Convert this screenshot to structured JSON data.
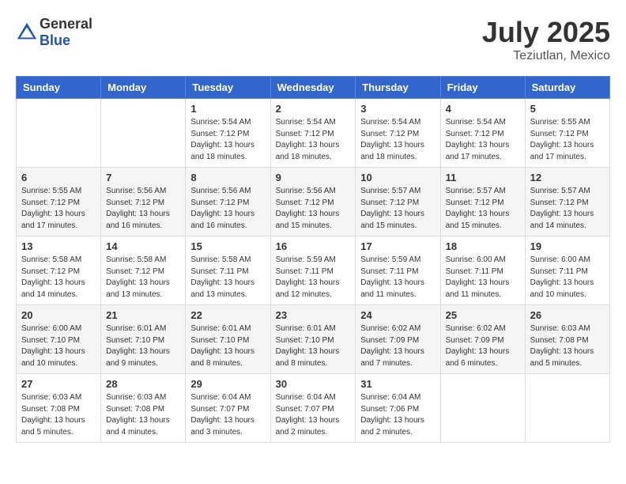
{
  "header": {
    "logo_general": "General",
    "logo_blue": "Blue",
    "month": "July 2025",
    "location": "Teziutlan, Mexico"
  },
  "weekdays": [
    "Sunday",
    "Monday",
    "Tuesday",
    "Wednesday",
    "Thursday",
    "Friday",
    "Saturday"
  ],
  "weeks": [
    [
      {
        "day": "",
        "info": ""
      },
      {
        "day": "",
        "info": ""
      },
      {
        "day": "1",
        "info": "Sunrise: 5:54 AM\nSunset: 7:12 PM\nDaylight: 13 hours\nand 18 minutes."
      },
      {
        "day": "2",
        "info": "Sunrise: 5:54 AM\nSunset: 7:12 PM\nDaylight: 13 hours\nand 18 minutes."
      },
      {
        "day": "3",
        "info": "Sunrise: 5:54 AM\nSunset: 7:12 PM\nDaylight: 13 hours\nand 18 minutes."
      },
      {
        "day": "4",
        "info": "Sunrise: 5:54 AM\nSunset: 7:12 PM\nDaylight: 13 hours\nand 17 minutes."
      },
      {
        "day": "5",
        "info": "Sunrise: 5:55 AM\nSunset: 7:12 PM\nDaylight: 13 hours\nand 17 minutes."
      }
    ],
    [
      {
        "day": "6",
        "info": "Sunrise: 5:55 AM\nSunset: 7:12 PM\nDaylight: 13 hours\nand 17 minutes."
      },
      {
        "day": "7",
        "info": "Sunrise: 5:56 AM\nSunset: 7:12 PM\nDaylight: 13 hours\nand 16 minutes."
      },
      {
        "day": "8",
        "info": "Sunrise: 5:56 AM\nSunset: 7:12 PM\nDaylight: 13 hours\nand 16 minutes."
      },
      {
        "day": "9",
        "info": "Sunrise: 5:56 AM\nSunset: 7:12 PM\nDaylight: 13 hours\nand 15 minutes."
      },
      {
        "day": "10",
        "info": "Sunrise: 5:57 AM\nSunset: 7:12 PM\nDaylight: 13 hours\nand 15 minutes."
      },
      {
        "day": "11",
        "info": "Sunrise: 5:57 AM\nSunset: 7:12 PM\nDaylight: 13 hours\nand 15 minutes."
      },
      {
        "day": "12",
        "info": "Sunrise: 5:57 AM\nSunset: 7:12 PM\nDaylight: 13 hours\nand 14 minutes."
      }
    ],
    [
      {
        "day": "13",
        "info": "Sunrise: 5:58 AM\nSunset: 7:12 PM\nDaylight: 13 hours\nand 14 minutes."
      },
      {
        "day": "14",
        "info": "Sunrise: 5:58 AM\nSunset: 7:12 PM\nDaylight: 13 hours\nand 13 minutes."
      },
      {
        "day": "15",
        "info": "Sunrise: 5:58 AM\nSunset: 7:11 PM\nDaylight: 13 hours\nand 13 minutes."
      },
      {
        "day": "16",
        "info": "Sunrise: 5:59 AM\nSunset: 7:11 PM\nDaylight: 13 hours\nand 12 minutes."
      },
      {
        "day": "17",
        "info": "Sunrise: 5:59 AM\nSunset: 7:11 PM\nDaylight: 13 hours\nand 11 minutes."
      },
      {
        "day": "18",
        "info": "Sunrise: 6:00 AM\nSunset: 7:11 PM\nDaylight: 13 hours\nand 11 minutes."
      },
      {
        "day": "19",
        "info": "Sunrise: 6:00 AM\nSunset: 7:11 PM\nDaylight: 13 hours\nand 10 minutes."
      }
    ],
    [
      {
        "day": "20",
        "info": "Sunrise: 6:00 AM\nSunset: 7:10 PM\nDaylight: 13 hours\nand 10 minutes."
      },
      {
        "day": "21",
        "info": "Sunrise: 6:01 AM\nSunset: 7:10 PM\nDaylight: 13 hours\nand 9 minutes."
      },
      {
        "day": "22",
        "info": "Sunrise: 6:01 AM\nSunset: 7:10 PM\nDaylight: 13 hours\nand 8 minutes."
      },
      {
        "day": "23",
        "info": "Sunrise: 6:01 AM\nSunset: 7:10 PM\nDaylight: 13 hours\nand 8 minutes."
      },
      {
        "day": "24",
        "info": "Sunrise: 6:02 AM\nSunset: 7:09 PM\nDaylight: 13 hours\nand 7 minutes."
      },
      {
        "day": "25",
        "info": "Sunrise: 6:02 AM\nSunset: 7:09 PM\nDaylight: 13 hours\nand 6 minutes."
      },
      {
        "day": "26",
        "info": "Sunrise: 6:03 AM\nSunset: 7:08 PM\nDaylight: 13 hours\nand 5 minutes."
      }
    ],
    [
      {
        "day": "27",
        "info": "Sunrise: 6:03 AM\nSunset: 7:08 PM\nDaylight: 13 hours\nand 5 minutes."
      },
      {
        "day": "28",
        "info": "Sunrise: 6:03 AM\nSunset: 7:08 PM\nDaylight: 13 hours\nand 4 minutes."
      },
      {
        "day": "29",
        "info": "Sunrise: 6:04 AM\nSunset: 7:07 PM\nDaylight: 13 hours\nand 3 minutes."
      },
      {
        "day": "30",
        "info": "Sunrise: 6:04 AM\nSunset: 7:07 PM\nDaylight: 13 hours\nand 2 minutes."
      },
      {
        "day": "31",
        "info": "Sunrise: 6:04 AM\nSunset: 7:06 PM\nDaylight: 13 hours\nand 2 minutes."
      },
      {
        "day": "",
        "info": ""
      },
      {
        "day": "",
        "info": ""
      }
    ]
  ]
}
